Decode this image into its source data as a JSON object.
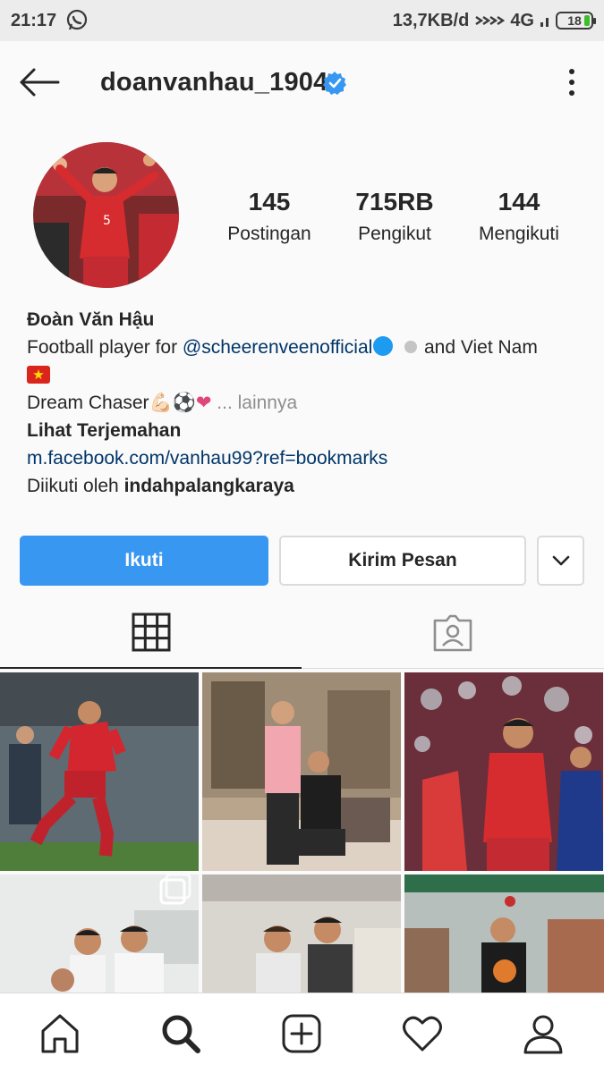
{
  "status_bar": {
    "time": "21:17",
    "network": "13,7KB/d",
    "signal": "4G",
    "battery": "18"
  },
  "header": {
    "username": "doanvanhau_1904"
  },
  "stats": {
    "posts_count": "145",
    "posts_label": "Postingan",
    "followers_count": "715RB",
    "followers_label": "Pengikut",
    "following_count": "144",
    "following_label": "Mengikuti"
  },
  "bio": {
    "name": "Đoàn Văn Hậu",
    "line1_prefix": "Football player for ",
    "line1_mention": "@scheerenveenofficial",
    "line1_suffix": " and Viet Nam",
    "line3_text": "Dream Chaser",
    "line3_emojis": "💪🏻⚽❤",
    "more_label": "... lainnya",
    "translate": "Lihat Terjemahan",
    "website": "m.facebook.com/vanhau99?ref=bookmarks",
    "followed_by_prefix": "Diikuti oleh ",
    "followed_by_user": "indahpalangkaraya"
  },
  "actions": {
    "follow": "Ikuti",
    "message": "Kirim Pesan"
  },
  "colors": {
    "accent": "#3897f0",
    "verified": "#3897f0",
    "link": "#003569"
  },
  "icons": {
    "back": "arrow-left",
    "more": "vertical-dots",
    "verified": "verified-badge",
    "grid_tab": "grid",
    "tagged_tab": "person-tag",
    "home": "home",
    "search": "search",
    "add": "plus-square",
    "activity": "heart",
    "profile": "person"
  }
}
